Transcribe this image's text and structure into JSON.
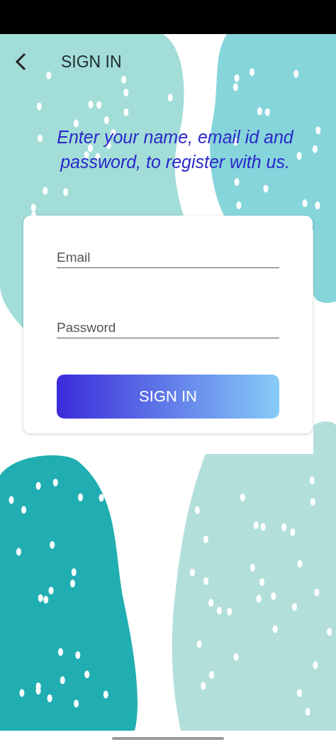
{
  "header": {
    "title": "SIGN IN"
  },
  "intro": "Enter your name, email id and password, to register with us.",
  "form": {
    "fields": [
      {
        "placeholder": "Email"
      },
      {
        "placeholder": "Password"
      }
    ],
    "button": "SIGN IN"
  }
}
